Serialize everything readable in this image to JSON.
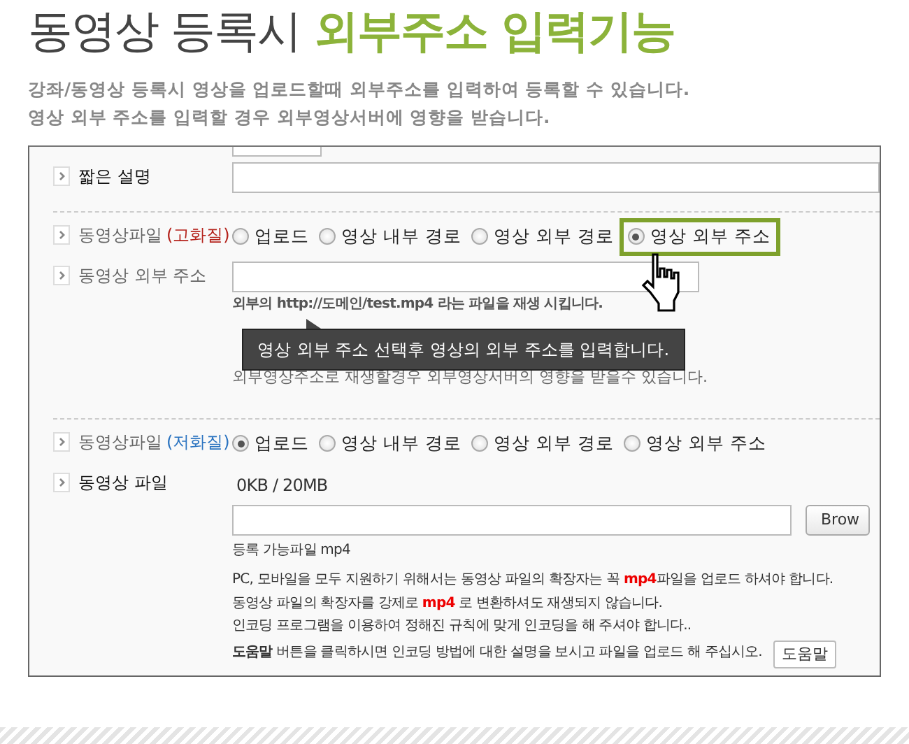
{
  "heading": {
    "plain": "동영상 등록시",
    "highlight": "외부주소 입력기능"
  },
  "intro": [
    "강좌/동영상 등록시 영상을 업로드할때 외부주소를 입력하여 등록할 수 있습니다.",
    "영상 외부 주소를 입력할 경우 외부영상서버에 영향을 받습니다."
  ],
  "form": {
    "sections": [
      [
        {
          "kind": "stub"
        },
        {
          "kind": "text",
          "label": "짧은 설명",
          "strong": true
        }
      ],
      [
        {
          "kind": "radios",
          "label": "동영상파일",
          "strong": false,
          "quality": "(고화질)",
          "color": "#b4221b",
          "options": [
            {
              "label": "업로드",
              "selected": false,
              "highlighted": false
            },
            {
              "label": "영상 내부 경로",
              "selected": false,
              "highlighted": false
            },
            {
              "label": "영상 외부 경로",
              "selected": false,
              "highlighted": false
            },
            {
              "label": "영상 외부 주소",
              "selected": true,
              "highlighted": true
            }
          ]
        },
        {
          "kind": "url",
          "label": "동영상 외부 주소",
          "strong": false,
          "notes": [
            {
              "text": "외부의 http://도메인/test.mp4 라는 파일을 재생 시킵니다.",
              "bold": true
            },
            {
              "text": "외부영상주소로 재생할경우 외부영상서버의 영향을 받을수 있습니다.",
              "bold": false
            }
          ],
          "tooltip": "영상 외부 주소 선택후 영상의 외부 주소를 입력합니다."
        }
      ],
      [
        {
          "kind": "radios",
          "label": "동영상파일",
          "strong": false,
          "quality": "(저화질)",
          "color": "#2a73c0",
          "options": [
            {
              "label": "업로드",
              "selected": true,
              "highlighted": false
            },
            {
              "label": "영상 내부 경로",
              "selected": false,
              "highlighted": false
            },
            {
              "label": "영상 외부 경로",
              "selected": false,
              "highlighted": false
            },
            {
              "label": "영상 외부 주소",
              "selected": false,
              "highlighted": false
            }
          ]
        },
        {
          "kind": "file",
          "label": "동영상 파일",
          "strong": true,
          "size": "0KB / 20MB",
          "button": "Brow",
          "allowed": "등록 가능파일 mp4",
          "notes": [
            "PC, 모바일을 모두 지원하기 위해서는 동영상 파일의 확장자는 꼭 **mp4**파일을 업로드 하셔야 합니다.",
            "동영상 파일의 확장자를 강제로 **mp4** 로 변환하셔도 재생되지 않습니다.",
            "인코딩 프로그램을 이용하여 정해진 규칙에 맞게 인코딩을 해 주셔야 합니다.."
          ],
          "help": {
            "text": "**도움말** 버튼을 클릭하시면 인코딩 방법에 대한 설명을 보시고 파일을 업로드 해 주십시오.",
            "button": "도움말"
          }
        }
      ]
    ]
  }
}
